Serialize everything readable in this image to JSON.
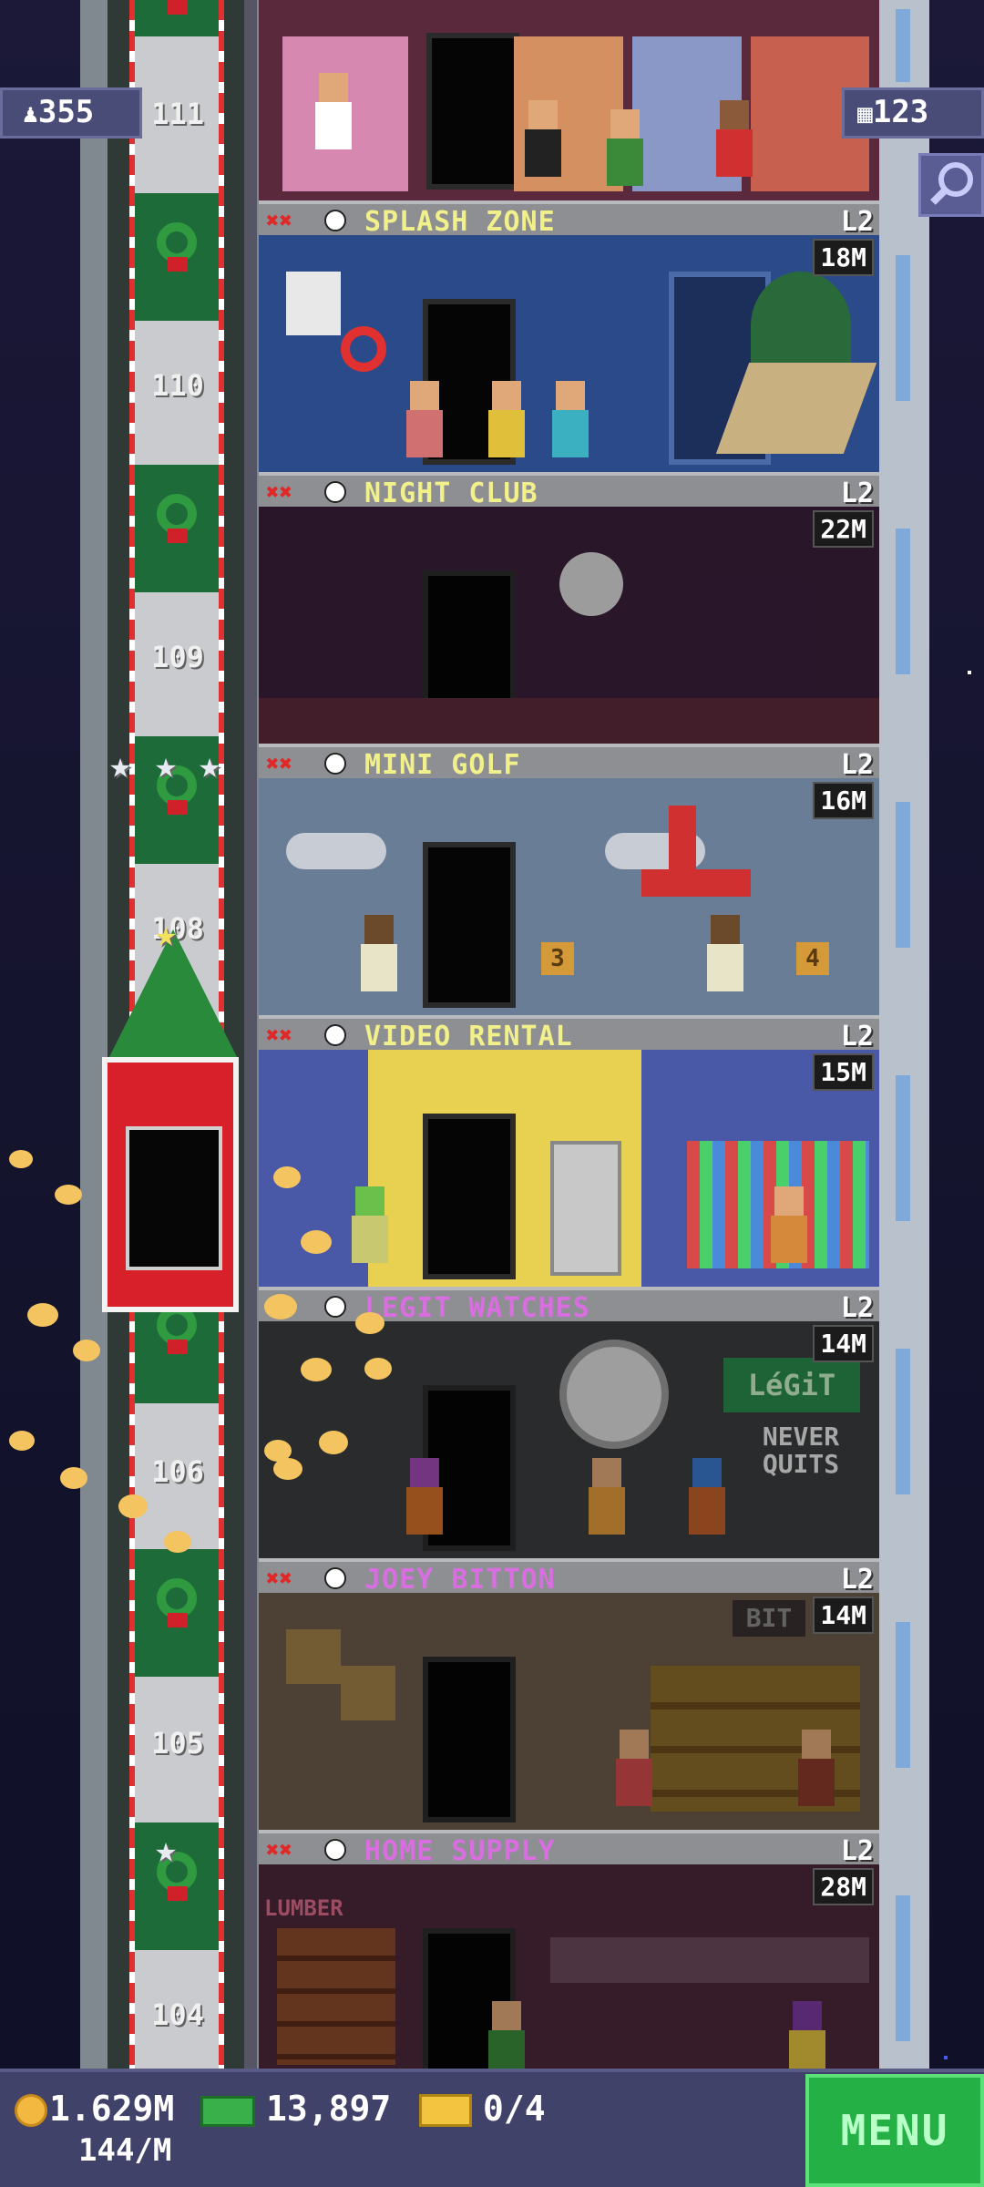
{
  "top_left": {
    "residents": "355"
  },
  "top_right": {
    "floors": "123"
  },
  "elevator_floor_numbers": [
    "111",
    "110",
    "109",
    "108",
    "106",
    "105",
    "104"
  ],
  "floors": [
    {
      "name": "SPLASH ZONE",
      "level": "L2",
      "price": "18M",
      "name_color": "#f2f08a",
      "bg": "#2a3f8a"
    },
    {
      "name": "NIGHT CLUB",
      "level": "L2",
      "price": "22M",
      "name_color": "#f2f08a",
      "bg": "#3a1f3a"
    },
    {
      "name": "MINI GOLF",
      "level": "L2",
      "price": "16M",
      "name_color": "#f2f08a",
      "bg": "#6a7d96"
    },
    {
      "name": "VIDEO RENTAL",
      "level": "L2",
      "price": "15M",
      "name_color": "#f2f08a",
      "bg": "#4a58a8"
    },
    {
      "name": "LEGIT WATCHES",
      "level": "L2",
      "price": "14M",
      "name_color": "#d86ee0",
      "bg": "#3a3c3e"
    },
    {
      "name": "JOEY BITTON",
      "level": "L2",
      "price": "14M",
      "name_color": "#d86ee0",
      "bg": "#6a5a48"
    },
    {
      "name": "HOME SUPPLY",
      "level": "L2",
      "price": "28M",
      "name_color": "#d86ee0",
      "bg": "#4a2838"
    }
  ],
  "room_signs": {
    "watch_brand": "LéGiT",
    "watch_slogan_1": "NEVER",
    "watch_slogan_2": "QUITS",
    "bitton_sign": "BIT",
    "lumber_sign": "LUMBER",
    "golf_hole_3": "3",
    "golf_hole_4": "4"
  },
  "bottom_bar": {
    "coins": "1.629M",
    "coins_rate": "144/M",
    "bux": "13,897",
    "tickets": "0/4",
    "menu_label": "MENU"
  },
  "colors": {
    "accent_green": "#24b044",
    "bar": "#40426a"
  }
}
